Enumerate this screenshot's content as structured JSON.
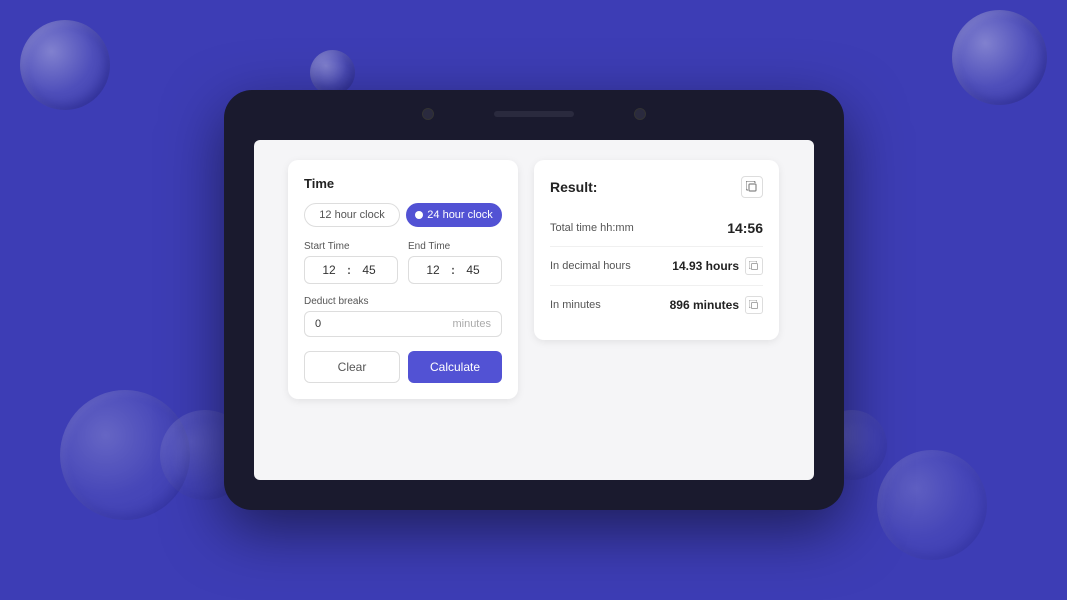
{
  "background": {
    "color": "#3d3db5"
  },
  "time_calculator": {
    "left_panel": {
      "section_title": "Time",
      "clock_options": [
        {
          "id": "12hour",
          "label": "12 hour clock",
          "active": false
        },
        {
          "id": "24hour",
          "label": "24 hour clock",
          "active": true
        }
      ],
      "start_time": {
        "label": "Start Time",
        "hours": "12",
        "minutes": "45"
      },
      "end_time": {
        "label": "End Time",
        "hours": "12",
        "minutes": "45"
      },
      "deduct_breaks": {
        "label": "Deduct breaks",
        "value": "0",
        "unit": "minutes"
      },
      "buttons": {
        "clear": "Clear",
        "calculate": "Calculate"
      }
    },
    "right_panel": {
      "title": "Result:",
      "rows": [
        {
          "label": "Total time hh:mm",
          "value": "14:56",
          "unit": ""
        },
        {
          "label": "In decimal hours",
          "value": "14.93",
          "unit": "hours"
        },
        {
          "label": "In minutes",
          "value": "896",
          "unit": "minutes"
        }
      ]
    }
  }
}
